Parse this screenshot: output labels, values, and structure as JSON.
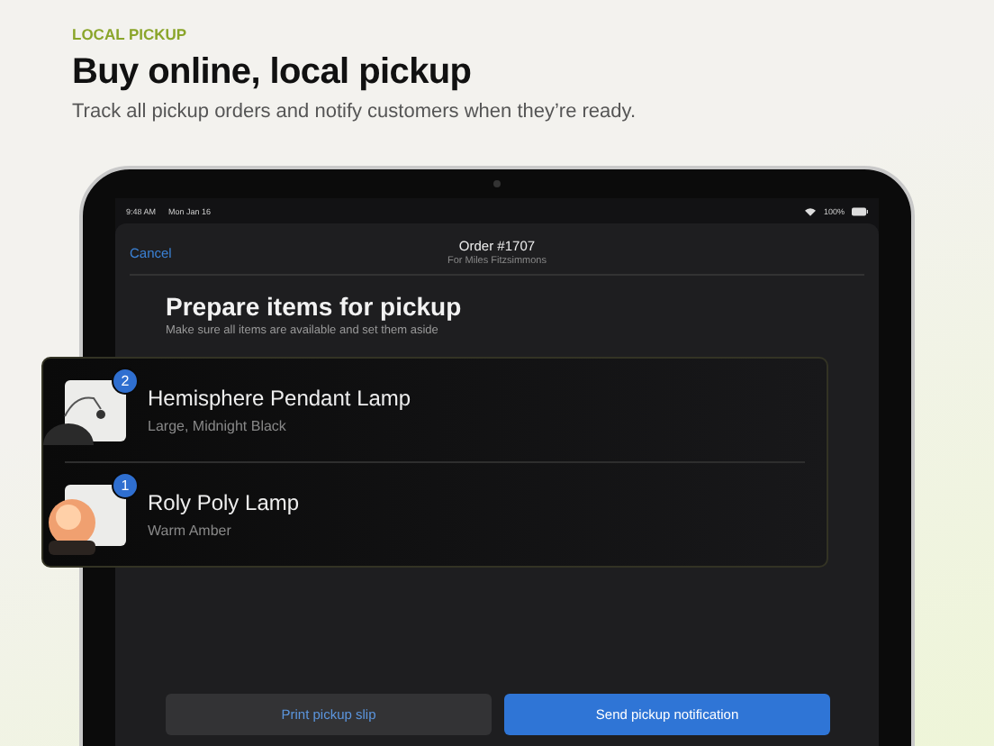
{
  "header": {
    "eyebrow": "LOCAL PICKUP",
    "title": "Buy online, local pickup",
    "subtitle": "Track all pickup orders and notify customers when they’re ready."
  },
  "status_bar": {
    "time": "9:48 AM",
    "date": "Mon Jan 16",
    "battery": "100%"
  },
  "nav": {
    "cancel": "Cancel",
    "title": "Order #1707",
    "subtitle": "For Miles Fitzsimmons"
  },
  "section": {
    "title": "Prepare items for pickup",
    "subtitle": "Make sure all items are available and set them aside"
  },
  "items": [
    {
      "kind": "pendant",
      "name": "Hemisphere Pendant Lamp",
      "variant": "Large, Midnight Black",
      "quantity": "2"
    },
    {
      "kind": "globe",
      "name": "Roly Poly Lamp",
      "variant": "Warm Amber",
      "quantity": "1"
    }
  ],
  "buttons": [
    {
      "label": "Print pickup slip",
      "kind": "secondary"
    },
    {
      "label": "Send pickup notification",
      "kind": "primary"
    }
  ]
}
